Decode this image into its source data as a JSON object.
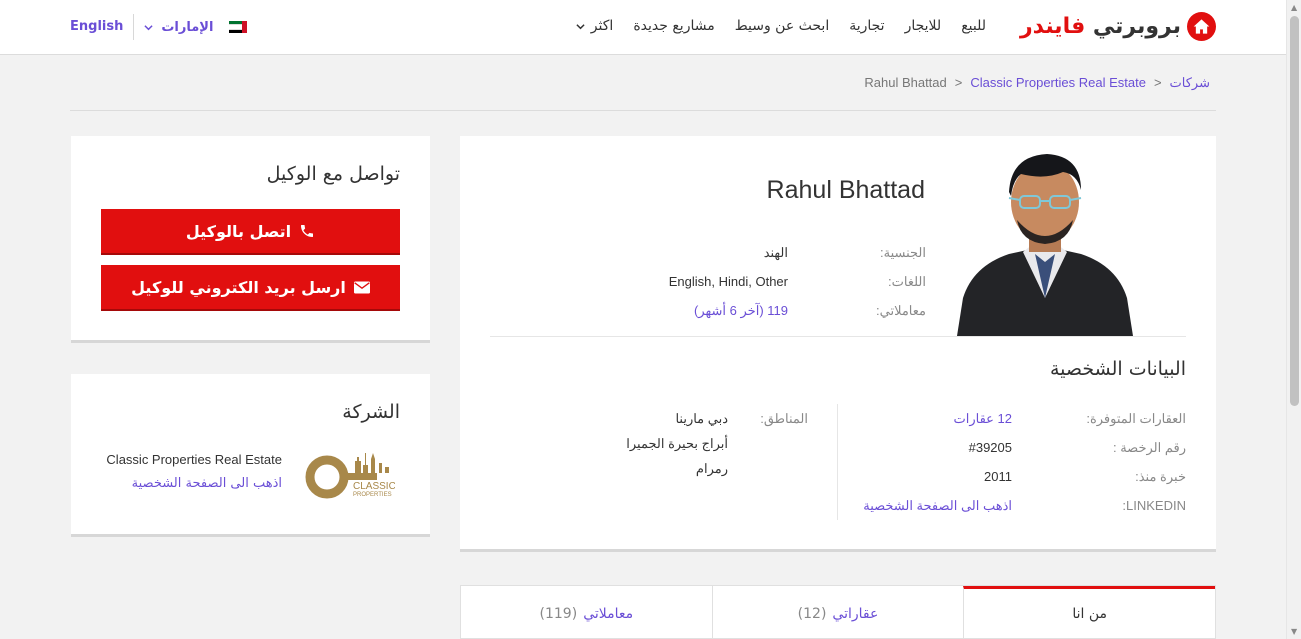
{
  "header": {
    "logo_part1": "بروبرتي",
    "logo_part2": "فايندر",
    "nav": [
      "للبيع",
      "للايجار",
      "تجارية",
      "ابحث عن وسيط",
      "مشاريع جديدة",
      "اكثر"
    ],
    "country": "الإمارات",
    "language": "English"
  },
  "breadcrumb": {
    "root": "شركات",
    "company": "Classic Properties Real Estate",
    "current": "Rahul Bhattad"
  },
  "agent": {
    "name": "Rahul Bhattad",
    "facts": [
      {
        "label": "الجنسية:",
        "value": "الهند",
        "link": false
      },
      {
        "label": "اللغات:",
        "value": "English, Hindi, Other",
        "link": false
      },
      {
        "label": "معاملاتي:",
        "value": "119 (آخر 6 أشهر)",
        "link": true
      }
    ]
  },
  "personal": {
    "title": "البيانات الشخصية",
    "rows": [
      {
        "label": "العقارات المتوفرة:",
        "value": "12 عقارات",
        "link": true
      },
      {
        "label": "رقم الرخصة :",
        "value": "#39205",
        "link": false
      },
      {
        "label": "خبرة منذ:",
        "value": "2011",
        "link": false
      },
      {
        "label": "LINKEDIN:",
        "value": "اذهب الى الصفحة الشخصية",
        "link": true
      }
    ],
    "areas_label": "المناطق:",
    "areas": [
      "دبي مارينا",
      "أبراج بحيرة الجميرا",
      "رمرام"
    ]
  },
  "tabs": [
    {
      "label": "من انا",
      "count": ""
    },
    {
      "label": "عقاراتي",
      "count": "(12)"
    },
    {
      "label": "معاملاتي",
      "count": "(119)"
    }
  ],
  "contact": {
    "title": "تواصل مع الوكيل",
    "call_label": "اتصل بالوكيل",
    "email_label": "ارسل بريد الكتروني للوكيل"
  },
  "company": {
    "title": "الشركة",
    "name": "Classic Properties Real Estate",
    "link": "اذهب الى الصفحة الشخصية",
    "logo_text": "CLASSIC",
    "logo_subtext": "PROPERTIES"
  },
  "colors": {
    "brand_red": "#e10f0f",
    "link": "#6a4ed6"
  }
}
